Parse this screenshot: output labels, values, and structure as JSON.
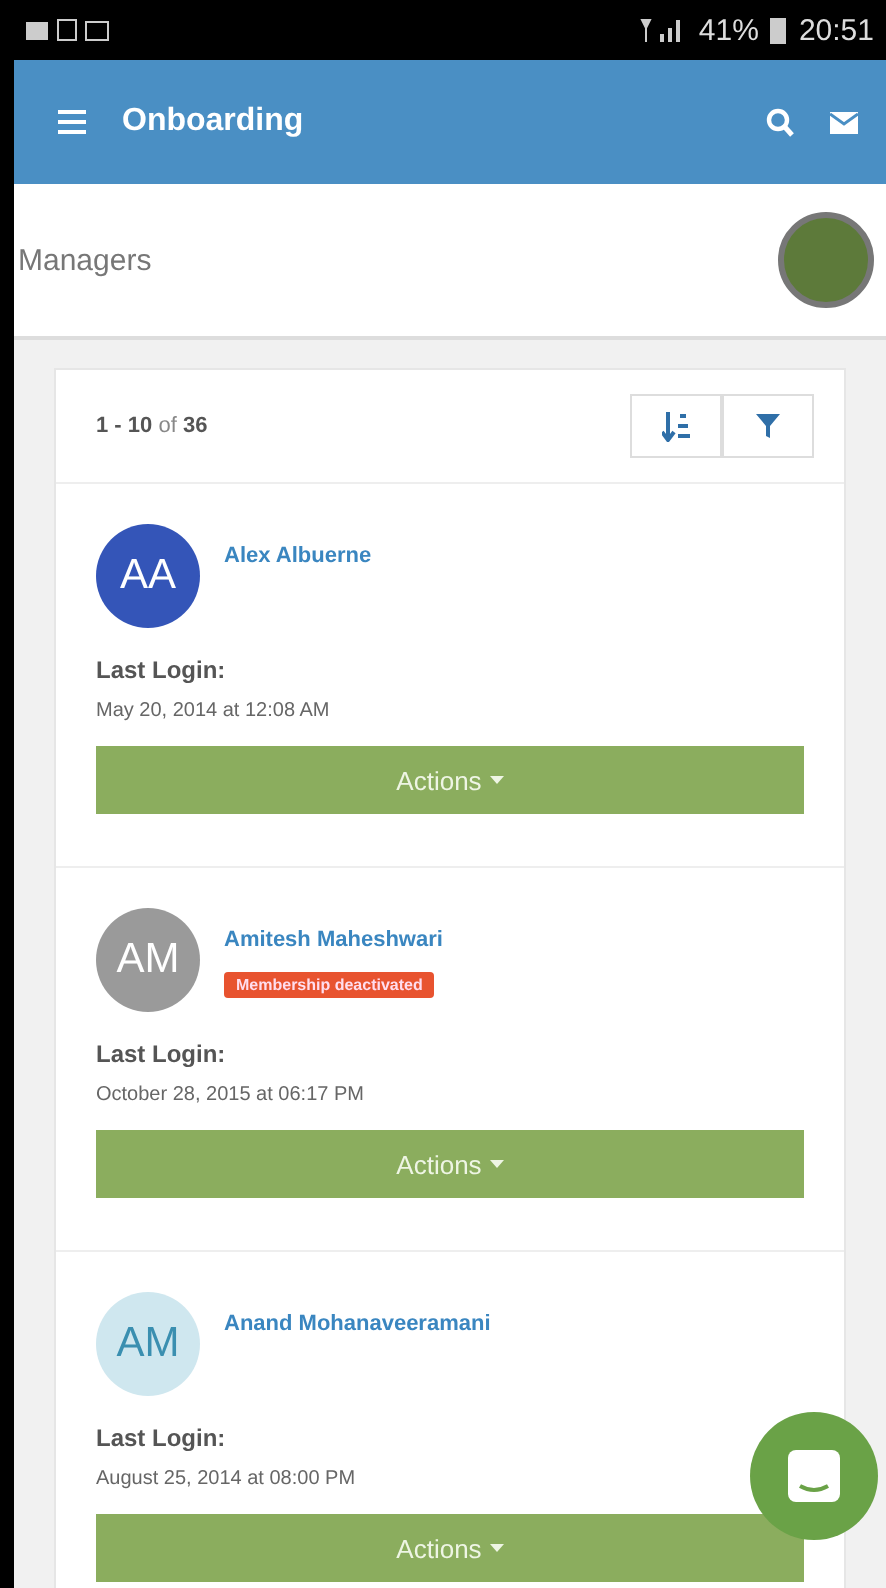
{
  "status_bar": {
    "battery": "41%",
    "time": "20:51"
  },
  "app_bar": {
    "title": "Onboarding"
  },
  "section": {
    "title": "Managers"
  },
  "list": {
    "range": "1 - 10",
    "of": "of",
    "total": "36",
    "items": [
      {
        "initials": "AA",
        "color": "#3455b8",
        "name": "Alex Albuerne",
        "login_label": "Last Login:",
        "login": "May 20, 2014 at 12:08 AM",
        "action": "Actions"
      },
      {
        "initials": "AM",
        "color": "#9a9a9a",
        "name": "Amitesh Maheshwari",
        "badge": "Membership deactivated",
        "login_label": "Last Login:",
        "login": "October 28, 2015 at 06:17 PM",
        "action": "Actions"
      },
      {
        "initials": "AM",
        "color": "#cfe7ef",
        "name": "Anand Mohanaveeramani",
        "login_label": "Last Login:",
        "login": "August 25, 2014 at 08:00 PM",
        "action": "Actions"
      }
    ]
  }
}
